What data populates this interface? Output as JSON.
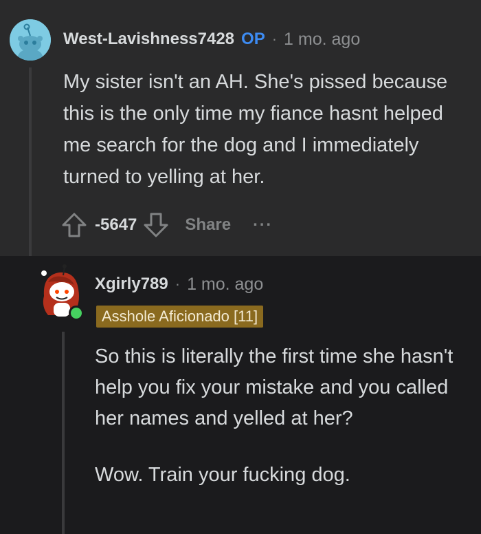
{
  "comment1": {
    "username": "West-Lavishness7428",
    "op_badge": "OP",
    "separator": "·",
    "time": "1 mo. ago",
    "body": "My sister isn't an AH. She's pissed because this is the only time my fiance hasnt helped me search for the dog and I immediately turned to yelling at her.",
    "score": "-5647",
    "share_label": "Share",
    "more_label": "...",
    "avatar_icon": "snoo-avatar-icon",
    "accent_color": "#3d8bf2"
  },
  "comment2": {
    "username": "Xgirly789",
    "separator": "·",
    "time": "1 mo. ago",
    "flair": "Asshole Aficionado [11]",
    "flair_color": "#8a6a1f",
    "paragraphs": [
      "So this is literally the first time she hasn't help you fix your mistake and you called her names and yelled at her?",
      "Wow. Train your fucking dog."
    ],
    "avatar_icon": "snoo-avatar-icon",
    "online_status": "online",
    "online_color": "#46d160"
  }
}
